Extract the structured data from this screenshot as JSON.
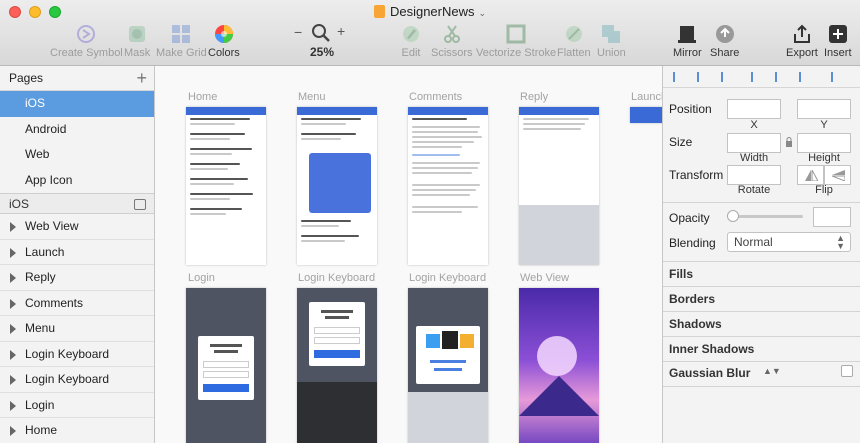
{
  "window": {
    "title": "DesignerNews"
  },
  "toolbar": {
    "create_symbol": "Create Symbol",
    "mask": "Mask",
    "make_grid": "Make Grid",
    "colors": "Colors",
    "zoom": "25%",
    "zoom_minus": "−",
    "zoom_plus": "+",
    "edit": "Edit",
    "scissors": "Scissors",
    "vectorize_stroke": "Vectorize Stroke",
    "flatten": "Flatten",
    "union": "Union",
    "mirror": "Mirror",
    "share": "Share",
    "export": "Export",
    "insert": "Insert"
  },
  "sidebar": {
    "pages_title": "Pages",
    "pages": [
      "iOS",
      "Android",
      "Web",
      "App Icon"
    ],
    "selected_page": "iOS",
    "layers_title": "iOS",
    "layers": [
      "Web View",
      "Launch",
      "Reply",
      "Comments",
      "Menu",
      "Login Keyboard",
      "Login Keyboard",
      "Login",
      "Home"
    ]
  },
  "canvas": {
    "row1_labels": [
      "Home",
      "Menu",
      "Comments",
      "Reply",
      "Launch"
    ],
    "row2_labels": [
      "Login",
      "Login Keyboard",
      "Login Keyboard",
      "Web View"
    ]
  },
  "inspector": {
    "position": "Position",
    "x": "X",
    "y": "Y",
    "size": "Size",
    "width": "Width",
    "height": "Height",
    "transform": "Transform",
    "rotate": "Rotate",
    "flip": "Flip",
    "opacity": "Opacity",
    "blending": "Blending",
    "blending_value": "Normal",
    "fills": "Fills",
    "borders": "Borders",
    "shadows": "Shadows",
    "inner_shadows": "Inner Shadows",
    "gaussian_blur": "Gaussian Blur"
  },
  "colors": {
    "accent": "#5b9bdf",
    "artboard_blue": "#3a6ad6"
  }
}
